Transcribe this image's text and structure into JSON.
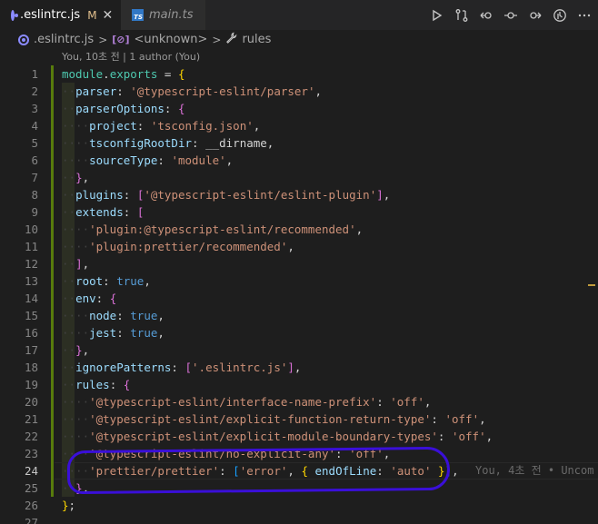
{
  "tabs": [
    {
      "label": ".eslintrc.js",
      "modified": "M",
      "icon": "eslint-circle-icon",
      "active": true
    },
    {
      "label": "main.ts",
      "icon": "typescript-file-icon",
      "active": false
    }
  ],
  "tab_close_glyph": "✕",
  "actions": [
    "run-icon",
    "compare-changes-icon",
    "go-back-icon",
    "commit-icon",
    "go-forward-icon",
    "timeline-icon",
    "more-actions-icon"
  ],
  "breadcrumb": {
    "file": ".eslintrc.js",
    "symbol_icon": "[⊘]",
    "symbol": "<unknown>",
    "rule": "rules"
  },
  "codelens": "You, 10초 전 | 1 author (You)",
  "current_line_blame": "You, 4초 전 • Uncom",
  "colors": {
    "accent": "#3a0fd9",
    "gutter_modified": "#587c0c",
    "string": "#ce9178",
    "keyword": "#569cd6"
  },
  "lines": [
    {
      "n": "1"
    },
    {
      "n": "2"
    },
    {
      "n": "3"
    },
    {
      "n": "4"
    },
    {
      "n": "5"
    },
    {
      "n": "6"
    },
    {
      "n": "7"
    },
    {
      "n": "8"
    },
    {
      "n": "9"
    },
    {
      "n": "10"
    },
    {
      "n": "11"
    },
    {
      "n": "12"
    },
    {
      "n": "13"
    },
    {
      "n": "14"
    },
    {
      "n": "15"
    },
    {
      "n": "16"
    },
    {
      "n": "17"
    },
    {
      "n": "18"
    },
    {
      "n": "19"
    },
    {
      "n": "20"
    },
    {
      "n": "21"
    },
    {
      "n": "22"
    },
    {
      "n": "23"
    },
    {
      "n": "24"
    },
    {
      "n": "25"
    },
    {
      "n": "26"
    },
    {
      "n": "27"
    }
  ],
  "code": {
    "l1": {
      "a": "module",
      "b": ".",
      "c": "exports",
      "d": " = ",
      "e": "{"
    },
    "l2": {
      "k": "parser",
      "c": ": ",
      "s": "'@typescript-eslint/parser'",
      "e": ","
    },
    "l3": {
      "k": "parserOptions",
      "c": ": ",
      "e": "{"
    },
    "l4": {
      "k": "project",
      "c": ": ",
      "s": "'tsconfig.json'",
      "e": ","
    },
    "l5": {
      "k": "tsconfigRootDir",
      "c": ": ",
      "v": "__dirname",
      "e": ","
    },
    "l6": {
      "k": "sourceType",
      "c": ": ",
      "s": "'module'",
      "e": ","
    },
    "l7": {
      "e": "}",
      "t": ","
    },
    "l8": {
      "k": "plugins",
      "c": ": ",
      "o": "[",
      "s": "'@typescript-eslint/eslint-plugin'",
      "e": "]",
      "t": ","
    },
    "l9": {
      "k": "extends",
      "c": ": ",
      "o": "["
    },
    "l10": {
      "s": "'plugin:@typescript-eslint/recommended'",
      "e": ","
    },
    "l11": {
      "s": "'plugin:prettier/recommended'",
      "e": ","
    },
    "l12": {
      "e": "]",
      "t": ","
    },
    "l13": {
      "k": "root",
      "c": ": ",
      "v": "true",
      "e": ","
    },
    "l14": {
      "k": "env",
      "c": ": ",
      "o": "{"
    },
    "l15": {
      "k": "node",
      "c": ": ",
      "v": "true",
      "e": ","
    },
    "l16": {
      "k": "jest",
      "c": ": ",
      "v": "true",
      "e": ","
    },
    "l17": {
      "e": "}",
      "t": ","
    },
    "l18": {
      "k": "ignorePatterns",
      "c": ": ",
      "o": "[",
      "s": "'.eslintrc.js'",
      "e": "]",
      "t": ","
    },
    "l19": {
      "k": "rules",
      "c": ": ",
      "o": "{"
    },
    "l20": {
      "s": "'@typescript-eslint/interface-name-prefix'",
      "c": ": ",
      "v": "'off'",
      "e": ","
    },
    "l21": {
      "s": "'@typescript-eslint/explicit-function-return-type'",
      "c": ": ",
      "v": "'off'",
      "e": ","
    },
    "l22": {
      "s": "'@typescript-eslint/explicit-module-boundary-types'",
      "c": ": ",
      "v": "'off'",
      "e": ","
    },
    "l23": {
      "s": "'@typescript-eslint/no-explicit-any'",
      "c": ": ",
      "v": "'off'",
      "e": ","
    },
    "l24": {
      "s": "'prettier/prettier'",
      "c": ": ",
      "o": "[",
      "s2": "'error'",
      "m": ", ",
      "o2": "{",
      "k": " endOfLine",
      "c2": ": ",
      "s3": "'auto'",
      "e2": " }",
      "e": "]",
      "t": ","
    },
    "l25": {
      "e": "}",
      "t": ","
    },
    "l26": {
      "e": "}",
      "t": ";"
    }
  }
}
